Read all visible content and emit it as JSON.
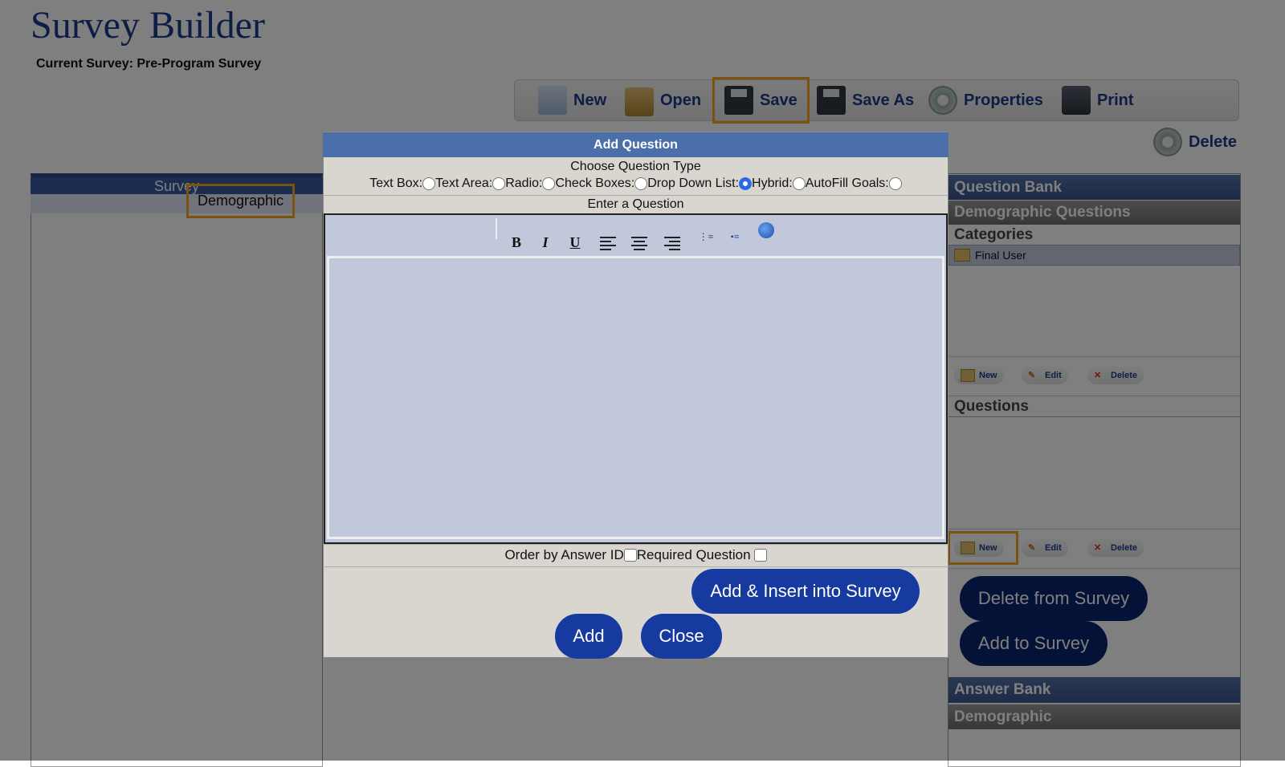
{
  "app": {
    "title": "Survey Builder",
    "current_survey": "Current Survey: Pre-Program Survey"
  },
  "toolbar": {
    "new": "New",
    "open": "Open",
    "save": "Save",
    "save_as": "Save As",
    "properties": "Properties",
    "print": "Print",
    "delete": "Delete"
  },
  "left_panel": {
    "header": "Survey",
    "section": "Demographic"
  },
  "right_panel": {
    "question_bank": "Question Bank",
    "demographic_questions": "Demographic Questions",
    "categories": "Categories",
    "category_item": "Final User",
    "questions": "Questions",
    "mini_new": "New",
    "mini_edit": "Edit",
    "mini_delete": "Delete",
    "delete_from_survey": "Delete from Survey",
    "add_to_survey": "Add to Survey",
    "answer_bank": "Answer Bank",
    "answer_demographic": "Demographic"
  },
  "modal": {
    "title": "Add Question",
    "choose_type": "Choose Question Type",
    "types": [
      "Text Box:",
      "Text Area:",
      "Radio:",
      "Check Boxes:",
      "Drop Down List:",
      "Hybrid:",
      "AutoFill Goals:"
    ],
    "selected_type": "Drop Down List:",
    "enter_question": "Enter a Question",
    "editor_buttons": {
      "bold": "B",
      "italic": "I",
      "underline": "U"
    },
    "order_by_answer": "Order by Answer ID",
    "required": "Required Question",
    "add_insert": "Add & Insert into Survey",
    "add": "Add",
    "close": "Close"
  },
  "colors": {
    "brand": "#1b3a8c",
    "button": "#163a9f",
    "highlight": "#f5a623",
    "modal_header": "#4a6fa9"
  }
}
